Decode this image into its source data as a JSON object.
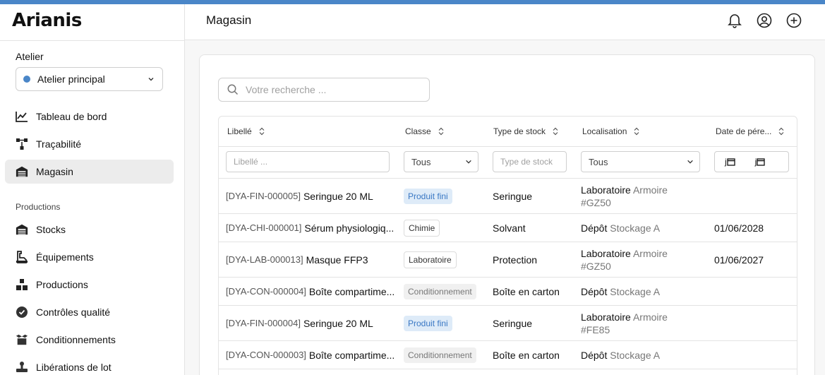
{
  "colors": {
    "accent": "#4a86c8",
    "badge_blue_bg": "#deebf8",
    "badge_gray_bg": "#f0f0f0"
  },
  "app": {
    "name": "Arianis"
  },
  "sidebar": {
    "workspace_label": "Atelier",
    "workspace_value": "Atelier principal",
    "items": [
      {
        "label": "Tableau de bord",
        "icon": "chart-line-icon"
      },
      {
        "label": "Traçabilité",
        "icon": "hierarchy-icon"
      },
      {
        "label": "Magasin",
        "icon": "warehouse-icon",
        "active": true
      }
    ],
    "section_label": "Productions",
    "section_items": [
      {
        "label": "Stocks",
        "icon": "warehouse-icon"
      },
      {
        "label": "Équipements",
        "icon": "equipment-icon"
      },
      {
        "label": "Productions",
        "icon": "boxes-icon"
      },
      {
        "label": "Contrôles qualité",
        "icon": "check-badge-icon"
      },
      {
        "label": "Conditionnements",
        "icon": "package-icon"
      },
      {
        "label": "Libérations de lot",
        "icon": "stamp-icon"
      }
    ]
  },
  "header": {
    "title": "Magasin",
    "icons": [
      "bell-icon",
      "user-circle-icon",
      "plus-circle-icon"
    ]
  },
  "search": {
    "placeholder": "Votre recherche ..."
  },
  "table": {
    "columns": [
      "Libellé",
      "Classe",
      "Type de stock",
      "Localisation",
      "Date de pére..."
    ],
    "filters": {
      "libelle_placeholder": "Libellé ...",
      "classe_value": "Tous",
      "type_placeholder": "Type de stock",
      "localisation_value": "Tous",
      "date_from": "j",
      "date_to": "j"
    },
    "rows": [
      {
        "code": "[DYA-FIN-000005]",
        "name": "Seringue 20 ML",
        "classe": "Produit fini",
        "badge": "blue",
        "type": "Seringue",
        "loc_main": "Laboratoire",
        "loc_sub": "Armoire",
        "loc_sub2": "#GZ50",
        "date": ""
      },
      {
        "code": "[DYA-CHI-000001]",
        "name": "Sérum physiologiq...",
        "classe": "Chimie",
        "badge": "white",
        "type": "Solvant",
        "loc_main": "Dépôt",
        "loc_sub": "Stockage A",
        "loc_sub2": "",
        "date": "01/06/2028"
      },
      {
        "code": "[DYA-LAB-000013]",
        "name": "Masque FFP3",
        "classe": "Laboratoire",
        "badge": "white",
        "type": "Protection",
        "loc_main": "Laboratoire",
        "loc_sub": "Armoire",
        "loc_sub2": "#GZ50",
        "date": "01/06/2027"
      },
      {
        "code": "[DYA-CON-000004]",
        "name": "Boîte compartime...",
        "classe": "Conditionnement",
        "badge": "gray",
        "type": "Boîte en carton",
        "loc_main": "Dépôt",
        "loc_sub": "Stockage A",
        "loc_sub2": "",
        "date": ""
      },
      {
        "code": "[DYA-FIN-000004]",
        "name": "Seringue 20 ML",
        "classe": "Produit fini",
        "badge": "blue",
        "type": "Seringue",
        "loc_main": "Laboratoire",
        "loc_sub": "Armoire",
        "loc_sub2": "#FE85",
        "date": ""
      },
      {
        "code": "[DYA-CON-000003]",
        "name": "Boîte compartime...",
        "classe": "Conditionnement",
        "badge": "gray",
        "type": "Boîte en carton",
        "loc_main": "Dépôt",
        "loc_sub": "Stockage A",
        "loc_sub2": "",
        "date": ""
      }
    ]
  }
}
